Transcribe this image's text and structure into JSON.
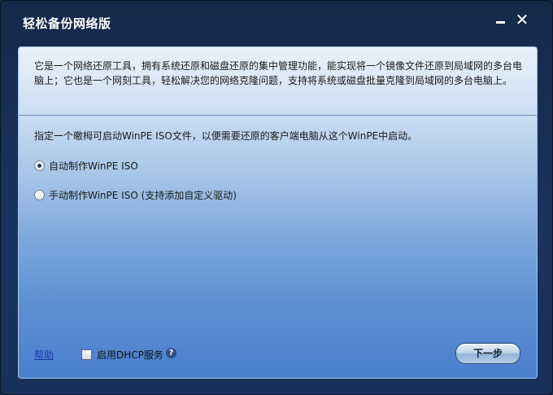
{
  "window": {
    "title": "轻松备份网络版",
    "minimize_label": "",
    "close_label": "✕"
  },
  "intro": {
    "text": "它是一个网络还原工具，拥有系统还原和磁盘还原的集中管理功能，能实现将一个镜像文件还原到局域网的多台电脑上；它也是一个网刻工具，轻松解决您的网络克隆问题，支持将系统或磁盘批量克隆到局域网的多台电脑上。"
  },
  "instruction": "指定一个皦栂可启动WinPE ISO文件，以便需要还原的客户端电脑从这个WinPE中启动。",
  "options": [
    {
      "label": "自动制作WinPE ISO",
      "checked": true
    },
    {
      "label": "手动制作WinPE ISO (支持添加自定义驱动)",
      "checked": false
    }
  ],
  "footer": {
    "help_label": "帮助",
    "dhcp_label": "启用DHCP服务",
    "dhcp_checked": false,
    "help_icon_glyph": "?",
    "next_label": "下一步"
  },
  "icons": {
    "minimize": "minimize-icon",
    "close": "close-icon",
    "help": "question-icon"
  }
}
